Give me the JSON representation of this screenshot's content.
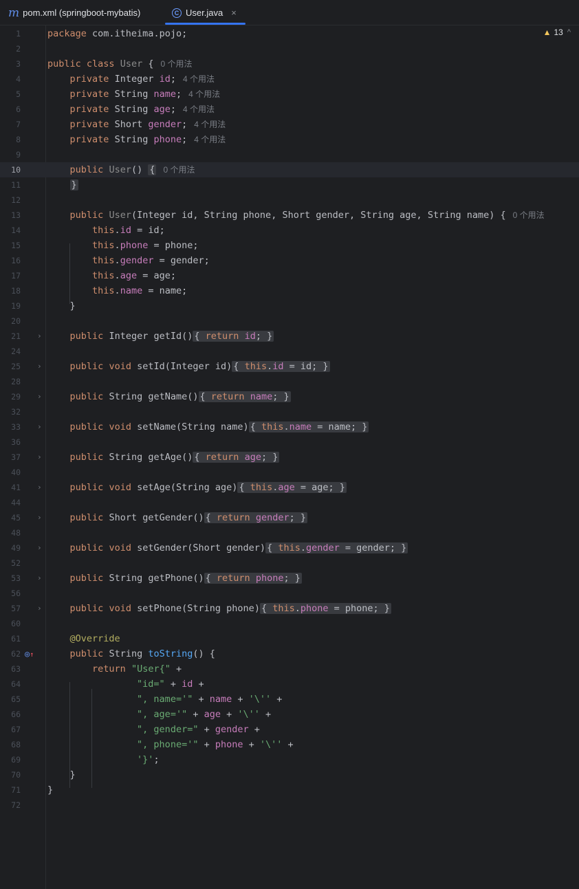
{
  "tabs": [
    {
      "icon": "m",
      "label": "pom.xml (springboot-mybatis)"
    },
    {
      "icon": "C",
      "label": "User.java",
      "close": "×"
    }
  ],
  "inspection": {
    "warning_count": "13",
    "chevron": "^"
  },
  "usage_hints": {
    "zero": "0 个用法",
    "four": "4 个用法"
  },
  "lines": [
    {
      "n": "1"
    },
    {
      "n": "2"
    },
    {
      "n": "3"
    },
    {
      "n": "4"
    },
    {
      "n": "5"
    },
    {
      "n": "6"
    },
    {
      "n": "7"
    },
    {
      "n": "8"
    },
    {
      "n": "9"
    },
    {
      "n": "10"
    },
    {
      "n": "11"
    },
    {
      "n": "12"
    },
    {
      "n": "13"
    },
    {
      "n": "14"
    },
    {
      "n": "15"
    },
    {
      "n": "16"
    },
    {
      "n": "17"
    },
    {
      "n": "18"
    },
    {
      "n": "19"
    },
    {
      "n": "20"
    },
    {
      "n": "21"
    },
    {
      "n": "24"
    },
    {
      "n": "25"
    },
    {
      "n": "28"
    },
    {
      "n": "29"
    },
    {
      "n": "32"
    },
    {
      "n": "33"
    },
    {
      "n": "36"
    },
    {
      "n": "37"
    },
    {
      "n": "40"
    },
    {
      "n": "41"
    },
    {
      "n": "44"
    },
    {
      "n": "45"
    },
    {
      "n": "48"
    },
    {
      "n": "49"
    },
    {
      "n": "52"
    },
    {
      "n": "53"
    },
    {
      "n": "56"
    },
    {
      "n": "57"
    },
    {
      "n": "60"
    },
    {
      "n": "61"
    },
    {
      "n": "62"
    },
    {
      "n": "63"
    },
    {
      "n": "64"
    },
    {
      "n": "65"
    },
    {
      "n": "66"
    },
    {
      "n": "67"
    },
    {
      "n": "68"
    },
    {
      "n": "69"
    },
    {
      "n": "70"
    },
    {
      "n": "71"
    },
    {
      "n": "72"
    }
  ],
  "code": {
    "package_kw": "package",
    "package_name": " com.itheima.pojo;",
    "public": "public",
    "class": "class",
    "private": "private",
    "void": "void",
    "return": "return",
    "this": "this",
    "class_name": "User",
    "Integer": "Integer",
    "String": "String",
    "Short": "Short",
    "id": "id",
    "name": "name",
    "age": "age",
    "gender": "gender",
    "phone": "phone",
    "override": "@Override",
    "toString": "toString",
    "getId": "getId",
    "setId": "setId",
    "getName": "getName",
    "setName": "setName",
    "getAge": "getAge",
    "setAge": "setAge",
    "getGender": "getGender",
    "setGender": "setGender",
    "getPhone": "getPhone",
    "setPhone": "setPhone",
    "str_user": "\"User{\"",
    "str_id": "\"id=\"",
    "str_name": "\", name='\"",
    "str_age": "\", age='\"",
    "str_gender": "\", gender=\"",
    "str_phone": "\", phone='\"",
    "str_quote": "'\\''",
    "str_close": "'}'"
  }
}
